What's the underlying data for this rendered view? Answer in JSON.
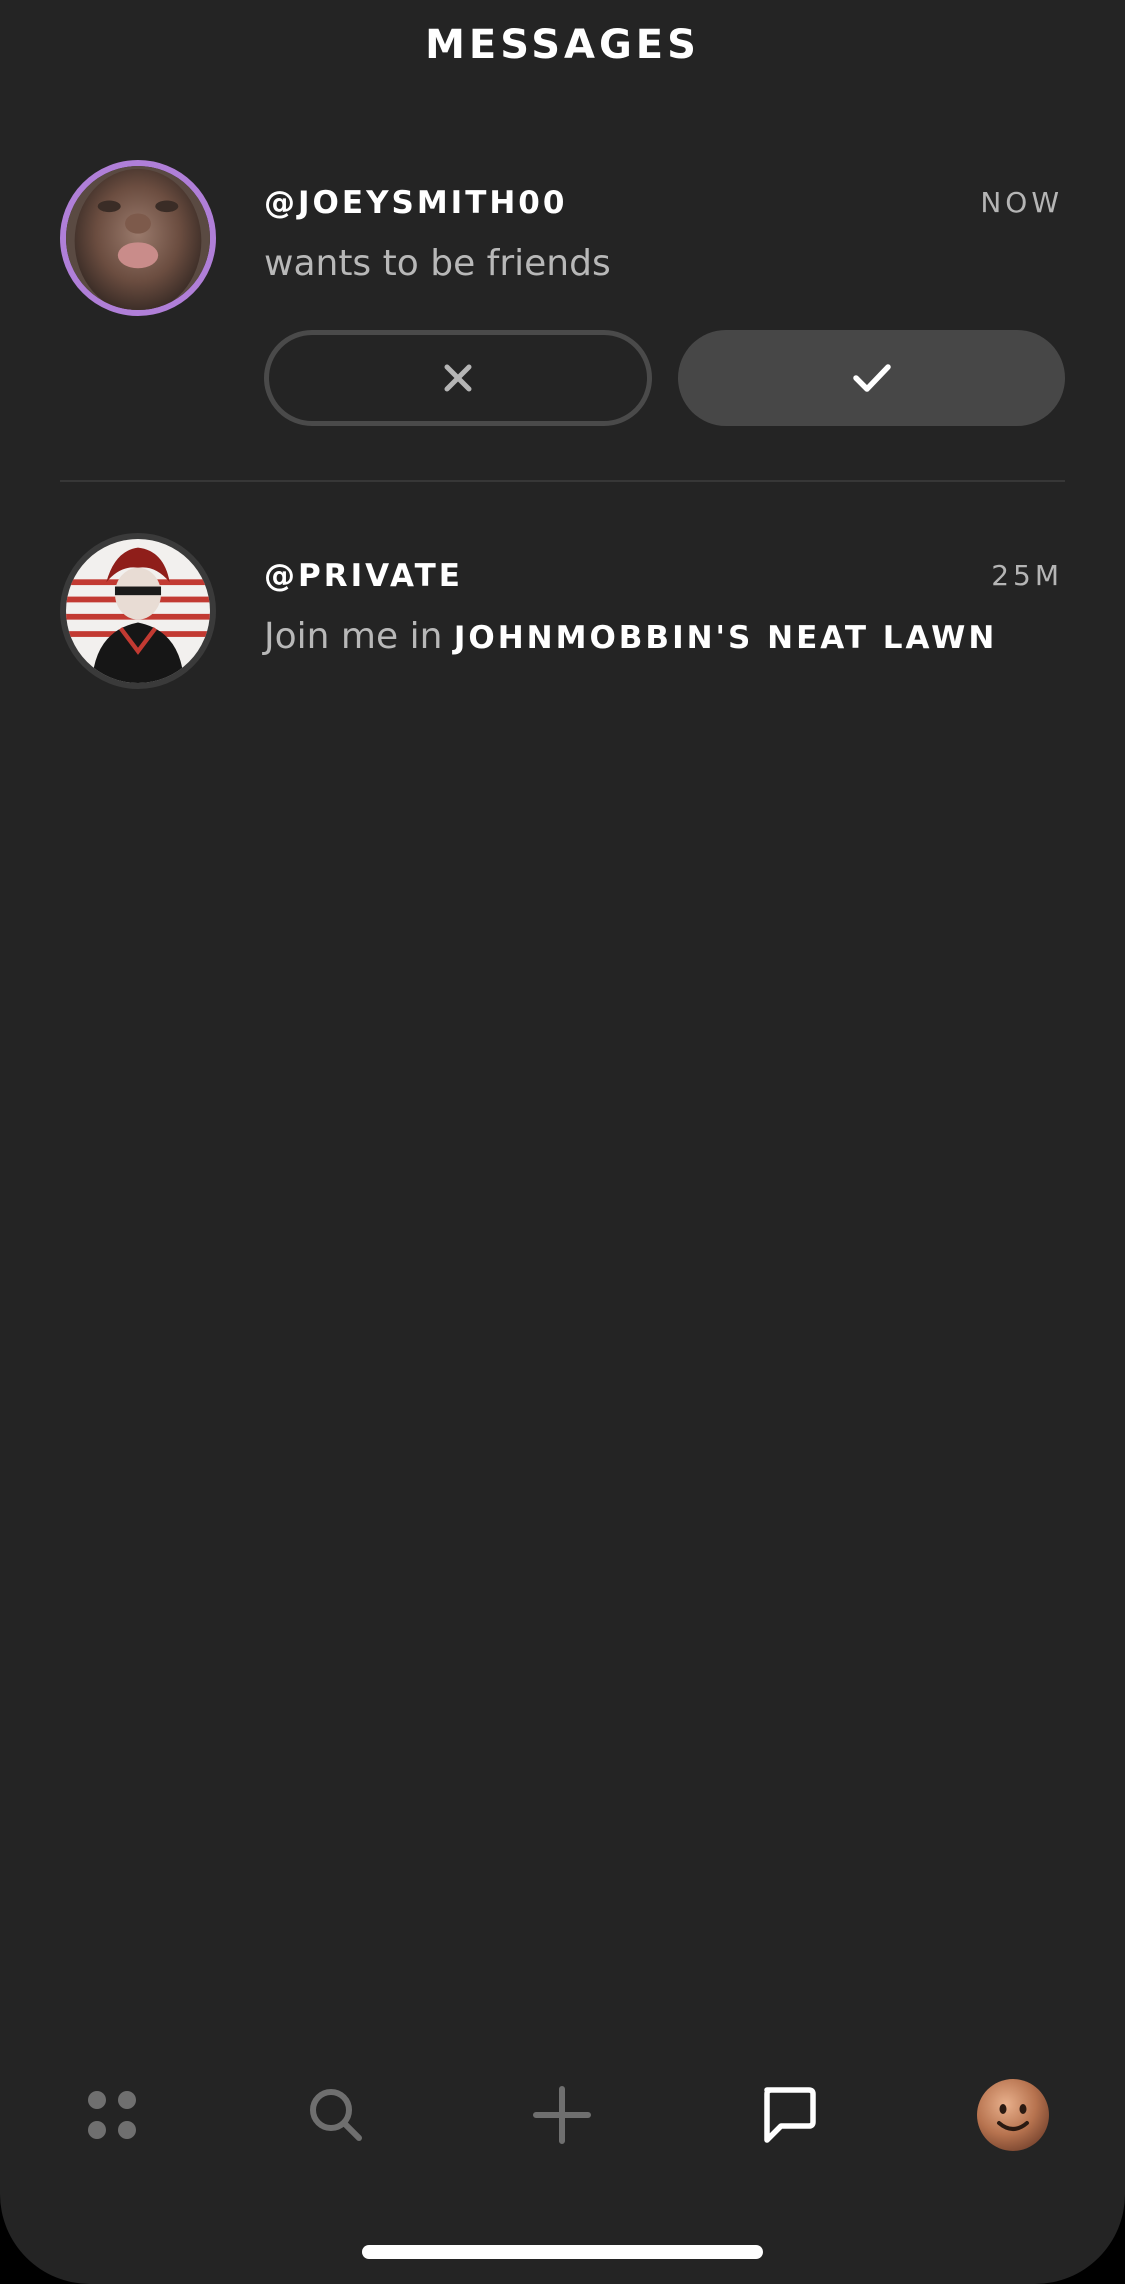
{
  "header": {
    "title": "MESSAGES"
  },
  "messages": [
    {
      "username": "@JOEYSMITH00",
      "time": "NOW",
      "text": "wants to be friends",
      "avatar_ring_color": "#b07fd8",
      "actions": {
        "decline_icon": "close-icon",
        "accept_icon": "check-icon"
      }
    },
    {
      "username": "@PRIVATE",
      "time": "25M",
      "text_prefix": "Join me in ",
      "text_highlight": "JOHNMOBBIN'S NEAT LAWN",
      "avatar_ring_color": "#3a3a3a"
    }
  ],
  "tabbar": {
    "items": [
      {
        "icon": "grid-icon",
        "active": false
      },
      {
        "icon": "search-icon",
        "active": false
      },
      {
        "icon": "plus-icon",
        "active": false
      },
      {
        "icon": "chat-bubble-icon",
        "active": true
      },
      {
        "icon": "profile-avatar-icon",
        "active": false
      }
    ]
  },
  "colors": {
    "background": "#242424",
    "accent_ring": "#b07fd8",
    "icon_inactive": "#6f6f6f",
    "icon_active": "#ffffff"
  }
}
